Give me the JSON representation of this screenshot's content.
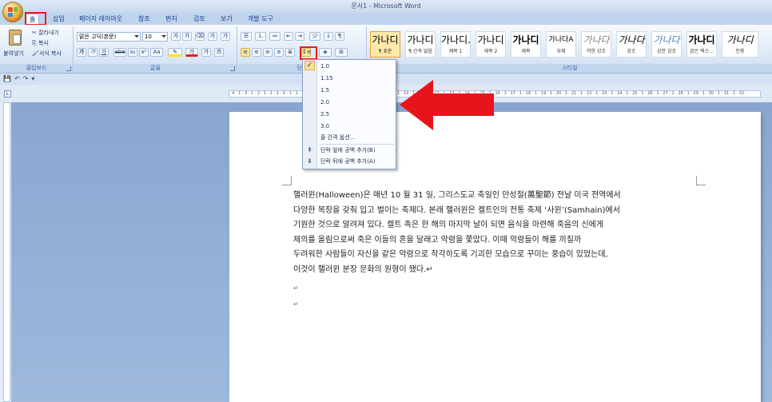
{
  "window": {
    "title": "문서1 - Microsoft Word"
  },
  "tabs": [
    {
      "label": "홈"
    },
    {
      "label": "삽입"
    },
    {
      "label": "페이지 레이아웃"
    },
    {
      "label": "참조"
    },
    {
      "label": "편지"
    },
    {
      "label": "검토"
    },
    {
      "label": "보기"
    },
    {
      "label": "개발 도구"
    }
  ],
  "clipboard": {
    "paste_label": "붙여넣기",
    "cut_label": "잘라내기",
    "copy_label": "복사",
    "format_painter_label": "서식 복사",
    "group_label": "클립보드"
  },
  "font": {
    "font_name": "맑은 고딕(본문)",
    "font_size": "10",
    "group_label": "글꼴",
    "grow_label": "가",
    "shrink_label": "가",
    "bold": "가",
    "italic": "가",
    "underline": "가",
    "strike": "abe",
    "subscript": "x₂",
    "superscript": "x²",
    "change_case": "Aa",
    "font_color": "가"
  },
  "paragraph": {
    "group_label": "단락"
  },
  "styles": {
    "group_label": "스타일",
    "items": [
      {
        "sample": "가나디",
        "name": "¶ 표준"
      },
      {
        "sample": "가나디",
        "name": "¶ 간격 없음"
      },
      {
        "sample": "가나디.",
        "name": "제목 1"
      },
      {
        "sample": "가나디",
        "name": "제목 2"
      },
      {
        "sample": "가나디",
        "name": "제목"
      },
      {
        "sample": "가나다A",
        "name": "부제"
      },
      {
        "sample": "가나다",
        "name": "약한 강조"
      },
      {
        "sample": "가나다",
        "name": "강조"
      },
      {
        "sample": "가나다",
        "name": "강한 강조"
      },
      {
        "sample": "가나디",
        "name": "굵은 텍스..."
      },
      {
        "sample": "가나디",
        "name": "인용"
      }
    ]
  },
  "line_spacing_menu": {
    "options": [
      "1.0",
      "1.15",
      "1.5",
      "2.0",
      "2.5",
      "3.0"
    ],
    "checked": "1.0",
    "line_spacing_options": "줄 간격 옵션...",
    "add_space_before": "단락 앞에 공백 추가(B)",
    "add_space_after": "단락 뒤에 공백 추가(A)"
  },
  "ruler": {
    "ticks": "· 4 · 1 · 3 · 1 · 2 · 1 · 1 · 1 · X · 1 · 1 · 2 · 1 · 3 · 1 · 4 · 1 · 5 · 1 · 6 · 1 · 7 · 1 · 8 · 1 · 9 · 1 · 10 · 1 · 11 · 1 · 12 · 1 · 13 · 1 · 14 · 1 · 15 · 1 · 16 · 1 · 17 · 1 · 18 · 1 · 19 · 1 · 20 · 1 · 21 · 1 · 22 · 1 · 23 · 1 · 24 · 1 · 25 · 1 · 26 · 1 · 27 · 1 · 28 · 1 · 29 · 1 · 30 · 1 · 31 · 1 · 32 ·"
  },
  "document": {
    "lines": [
      "핼러윈(Halloween)은  매년  10 월  31 일,  그리스도교  축일인  만성절(萬聖節)  전날  미국  전역에서",
      "다양한 복장을 갖춰 입고 벌이는 축제다. 본래 핼러윈은 켈트인의 전통 축제 ‘사윈’(Samhain)에서",
      "기원한  것으로  알려져  있다.  켈트  족은  한  해의  마지막  날이  되면  음식을  마련해  죽음의  신에게",
      "제의를 올림으로써 죽은 이들의 혼을 달래고 악령을 쫓았다. 이때 악령들이 해를 끼칠까",
      "두려워한 사람들이 자신을 같은 악령으로 착각하도록 기괴한 모습으로 꾸미는 풍습이 있었는데,",
      "이것이 핼러윈 분장 문화의 원형이 됐다.↵"
    ],
    "para_mark": "↵"
  },
  "colors": {
    "accent": "#e02020",
    "ribbon": "#dbe7f6",
    "workspace": "#8aa6d0"
  }
}
